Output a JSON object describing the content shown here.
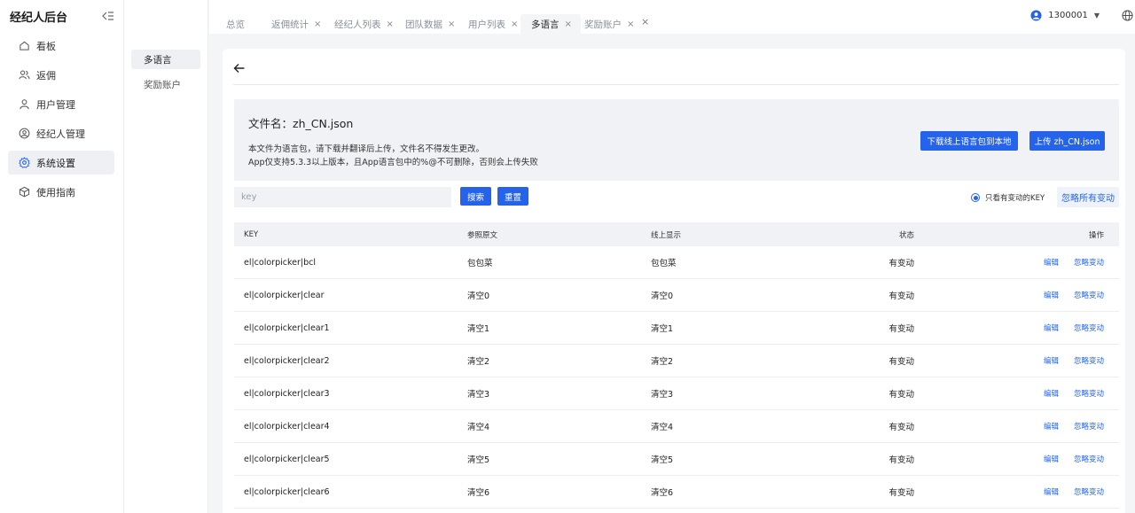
{
  "app": {
    "title": "经纪人后台"
  },
  "sidebar": {
    "items": [
      {
        "label": "看板",
        "icon": "home-icon"
      },
      {
        "label": "返佣",
        "icon": "users-icon"
      },
      {
        "label": "用户管理",
        "icon": "user-icon"
      },
      {
        "label": "经纪人管理",
        "icon": "user-circle-icon"
      },
      {
        "label": "系统设置",
        "icon": "gear-icon",
        "active": true
      },
      {
        "label": "使用指南",
        "icon": "cube-icon"
      }
    ]
  },
  "subnav": {
    "items": [
      {
        "label": "多语言",
        "active": true
      },
      {
        "label": "奖励账户"
      }
    ]
  },
  "tabs": [
    {
      "label": "总览"
    },
    {
      "label": "返佣统计"
    },
    {
      "label": "经纪人列表"
    },
    {
      "label": "团队数据"
    },
    {
      "label": "用户列表"
    },
    {
      "label": "多语言",
      "active": true
    },
    {
      "label": "奖励账户"
    }
  ],
  "user": {
    "id": "1300001"
  },
  "info": {
    "filename_label": "文件名：",
    "filename": "zh_CN.json",
    "desc1": "本文件为语言包，请下载并翻译后上传，文件名不得发生更改。",
    "desc2": "App仅支持5.3.3以上版本，且App语言包中的%@不可删除，否则会上传失败",
    "download_label": "下载线上语言包到本地",
    "upload_label": "上传 zh_CN.json"
  },
  "filter": {
    "placeholder": "key",
    "search_label": "搜索",
    "reset_label": "重置",
    "only_changed_label": "只看有变动的KEY",
    "ignore_all_label": "忽略所有变动"
  },
  "table": {
    "headers": {
      "key": "KEY",
      "source": "参照原文",
      "online": "线上显示",
      "status": "状态",
      "action": "操作"
    },
    "edit_label": "编辑",
    "ignore_label": "忽略变动",
    "rows": [
      {
        "key": "el|colorpicker|bcl",
        "source": "包包菜",
        "online": "包包菜",
        "status": "有变动"
      },
      {
        "key": "el|colorpicker|clear",
        "source": "清空0",
        "online": "清空0",
        "status": "有变动"
      },
      {
        "key": "el|colorpicker|clear1",
        "source": "清空1",
        "online": "清空1",
        "status": "有变动"
      },
      {
        "key": "el|colorpicker|clear2",
        "source": "清空2",
        "online": "清空2",
        "status": "有变动"
      },
      {
        "key": "el|colorpicker|clear3",
        "source": "清空3",
        "online": "清空3",
        "status": "有变动"
      },
      {
        "key": "el|colorpicker|clear4",
        "source": "清空4",
        "online": "清空4",
        "status": "有变动"
      },
      {
        "key": "el|colorpicker|clear5",
        "source": "清空5",
        "online": "清空5",
        "status": "有变动"
      },
      {
        "key": "el|colorpicker|clear6",
        "source": "清空6",
        "online": "清空6",
        "status": "有变动"
      }
    ]
  },
  "colors": {
    "accent": "#2563eb"
  }
}
